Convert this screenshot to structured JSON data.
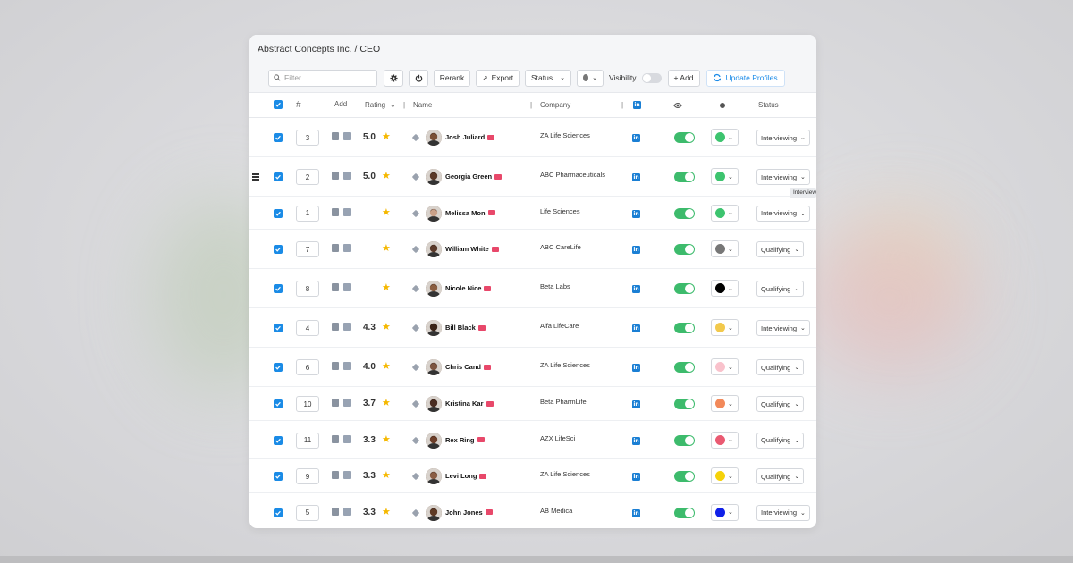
{
  "breadcrumb": "Abstract Concepts Inc. / CEO",
  "toolbar": {
    "filter_placeholder": "Filter",
    "rerank_label": "Rerank",
    "export_label": "Export",
    "status_label": "Status",
    "visibility_label": "Visibility",
    "add_label": "+ Add",
    "update_profiles_label": "Update Profiles"
  },
  "columns": {
    "number": "#",
    "add": "Add",
    "rating": "Rating",
    "name": "Name",
    "company": "Company",
    "status": "Status"
  },
  "rows": [
    {
      "num": "3",
      "rating": "5.0",
      "name": "Josh Juliard",
      "company": "ZA Life Sciences",
      "color": "#3dc46f",
      "status": "Interviewing"
    },
    {
      "num": "2",
      "rating": "5.0",
      "name": "Georgia Green",
      "company": "ABC Pharmaceuticals",
      "color": "#3dc46f",
      "status": "Interviewing"
    },
    {
      "num": "1",
      "rating": "",
      "name": "Melissa Mon",
      "company": "Life Sciences",
      "color": "#3dc46f",
      "status": "Interviewing"
    },
    {
      "num": "7",
      "rating": "",
      "name": "William White",
      "company": "ABC CareLife",
      "color": "#777777",
      "status": "Qualifying"
    },
    {
      "num": "8",
      "rating": "",
      "name": "Nicole Nice",
      "company": "Beta Labs",
      "color": "#000000",
      "status": "Qualifying"
    },
    {
      "num": "4",
      "rating": "4.3",
      "name": "Bill Black",
      "company": "Alfa LifeCare",
      "color": "#f2c94c",
      "status": "Interviewing"
    },
    {
      "num": "6",
      "rating": "4.0",
      "name": "Chris Cand",
      "company": "ZA Life Sciences",
      "color": "#f9c2cc",
      "status": "Qualifying"
    },
    {
      "num": "10",
      "rating": "3.7",
      "name": "Kristina Kar",
      "company": "Beta PharmLife",
      "color": "#f2895a",
      "status": "Qualifying"
    },
    {
      "num": "11",
      "rating": "3.3",
      "name": "Rex Ring",
      "company": "AZX LifeSci",
      "color": "#ea5a72",
      "status": "Qualifying"
    },
    {
      "num": "9",
      "rating": "3.3",
      "name": "Levi Long",
      "company": "ZA Life Sciences",
      "color": "#f5d20a",
      "status": "Qualifying"
    },
    {
      "num": "5",
      "rating": "3.3",
      "name": "John Jones",
      "company": "AB Medica",
      "color": "#1020e8",
      "status": "Interviewing"
    }
  ],
  "tooltip": "Interviewing",
  "colors": {
    "accent": "#1a8be6",
    "toggle_on": "#3dbb6c",
    "linkedin": "#1a7fd4",
    "star": "#f5b800"
  }
}
